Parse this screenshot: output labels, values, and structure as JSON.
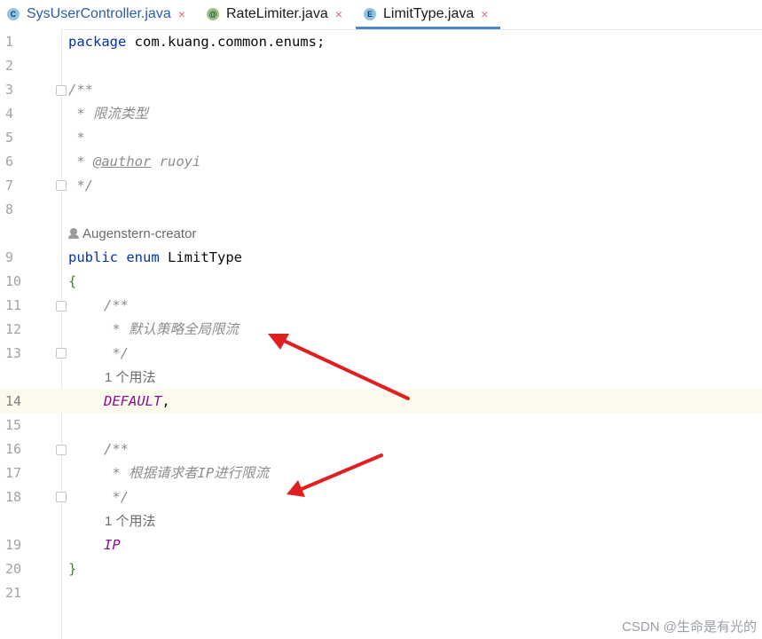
{
  "tabs": [
    {
      "label": "SysUserController.java",
      "icon": "class-icon",
      "badge": "C"
    },
    {
      "label": "RateLimiter.java",
      "icon": "annotation-icon",
      "badge": "@"
    },
    {
      "label": "LimitType.java",
      "icon": "enum-icon",
      "badge": "E"
    }
  ],
  "tab_close": "×",
  "editor": {
    "line_numbers": [
      "1",
      "2",
      "3",
      "4",
      "5",
      "6",
      "7",
      "8",
      "9",
      "10",
      "11",
      "12",
      "13",
      "14",
      "15",
      "16",
      "17",
      "18",
      "19",
      "20",
      "21"
    ],
    "line1": {
      "kw": "package",
      "rest": " com.kuang.common.enums;"
    },
    "line3": "/**",
    "line4": " * 限流类型",
    "line5": " *",
    "line6": {
      "prefix": " * ",
      "tag": "@author",
      "rest": " ruoyi"
    },
    "line7": " */",
    "author_hint": "Augenstern-creator",
    "line9": {
      "kw1": "public",
      "kw2": "enum",
      "name": "LimitType"
    },
    "line10": "{",
    "line11": "/**",
    "line12": " * 默认策略全局限流",
    "line13": " */",
    "usage_hint_1": "1 个用法",
    "line14": {
      "constant": "DEFAULT",
      "punct": ","
    },
    "line16": "/**",
    "line17": " * 根据请求者IP进行限流",
    "line18": " */",
    "usage_hint_2": "1 个用法",
    "line19": "IP",
    "line20": "}"
  },
  "watermark": "CSDN @生命是有光的",
  "colors": {
    "keyword": "#0033b3",
    "comment": "#8c8c8c",
    "enum_constant": "#871094",
    "brace": "#3d8a1f",
    "arrow": "#e02020",
    "current_line": "#fcfaed"
  }
}
